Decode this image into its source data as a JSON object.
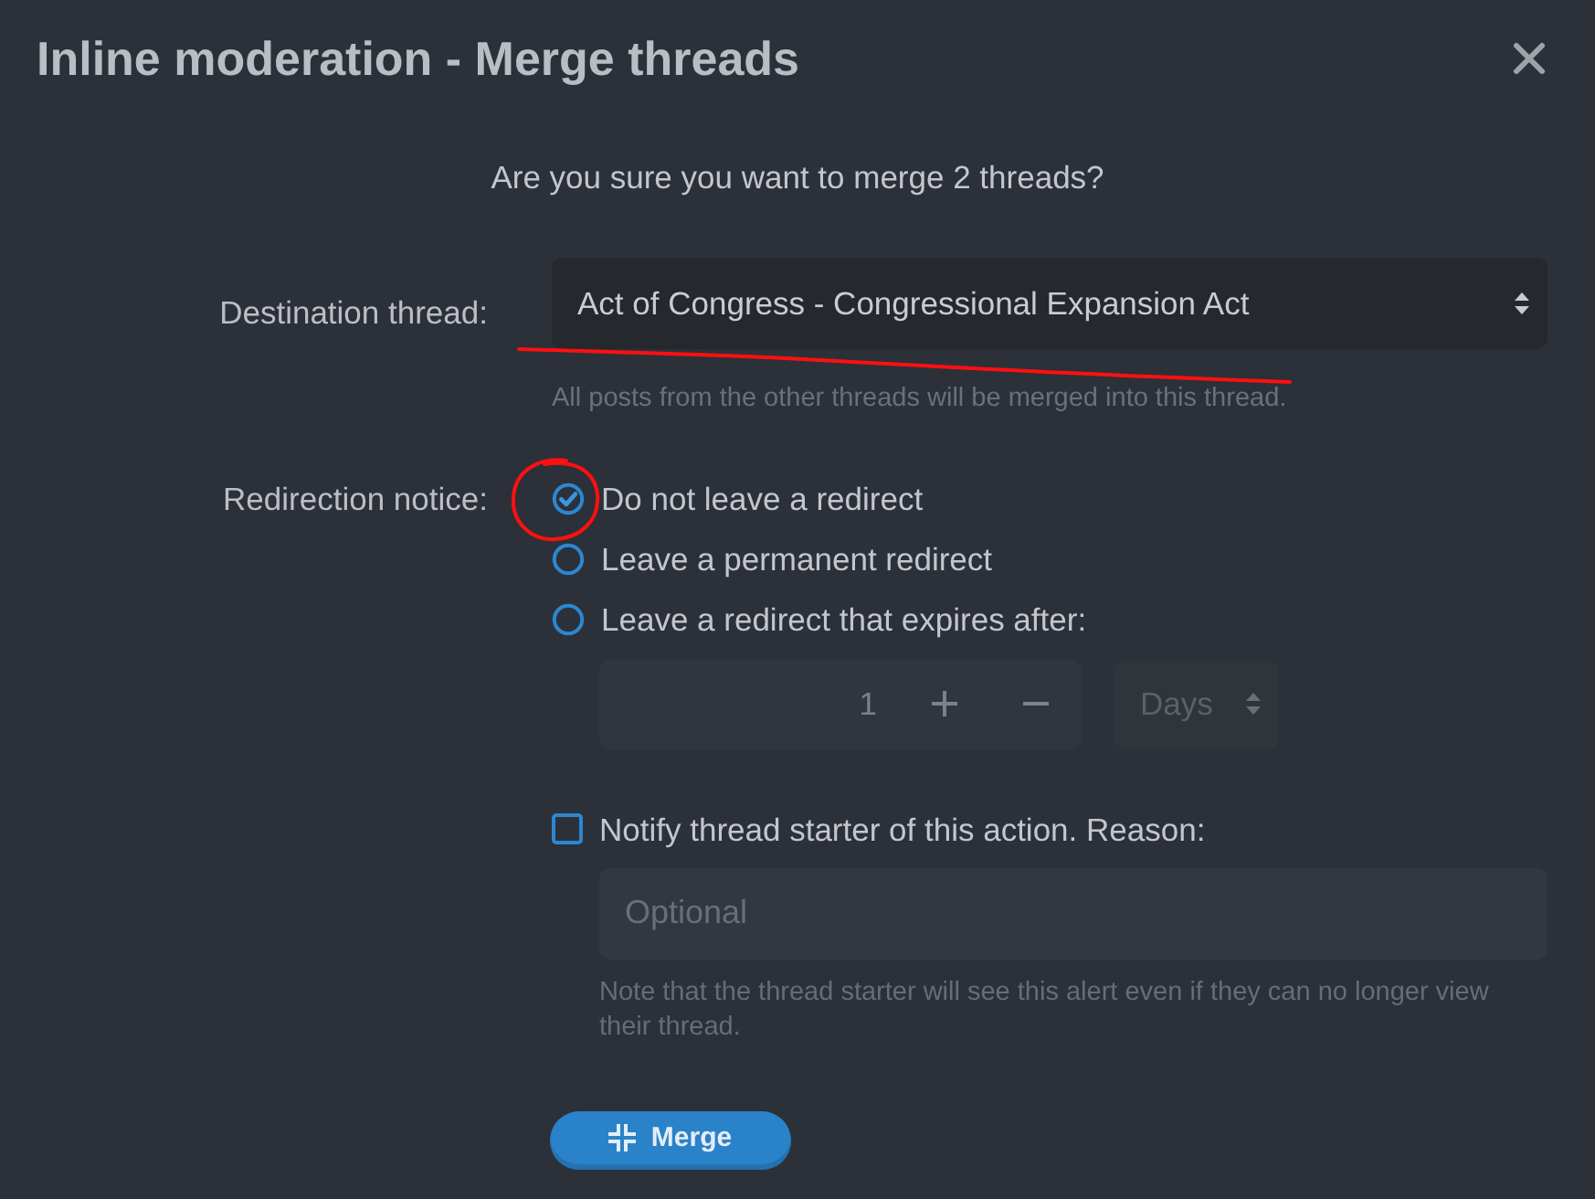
{
  "window": {
    "title": "Inline moderation - Merge threads"
  },
  "prompt": "Are you sure you want to merge 2 threads?",
  "destination": {
    "label": "Destination thread:",
    "value": "Act of Congress - Congressional Expansion Act",
    "hint": "All posts from the other threads will be merged into this thread."
  },
  "redirection": {
    "label": "Redirection notice:",
    "options": [
      {
        "label": "Do not leave a redirect",
        "selected": true
      },
      {
        "label": "Leave a permanent redirect",
        "selected": false
      },
      {
        "label": "Leave a redirect that expires after:",
        "selected": false
      }
    ],
    "expiry": {
      "value": "1",
      "unit": "Days",
      "disabled": true
    }
  },
  "notify": {
    "label": "Notify thread starter of this action. Reason:",
    "checked": false,
    "reason": {
      "placeholder": "Optional"
    },
    "note": "Note that the thread starter will see this alert even if they can no longer view their thread."
  },
  "submit": {
    "label": "Merge"
  },
  "markup": [
    {
      "kind": "stroke"
    },
    {
      "kind": "circle"
    }
  ]
}
